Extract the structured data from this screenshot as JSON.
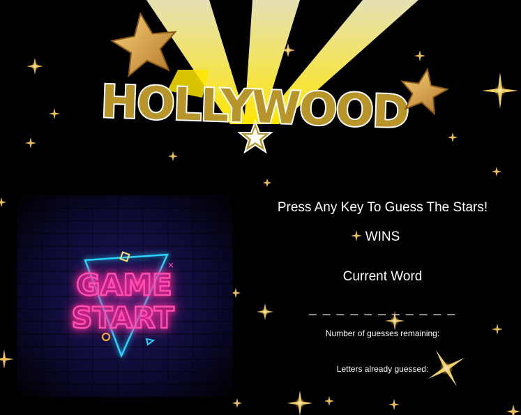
{
  "logo": {
    "text": "HOLLYWOOD"
  },
  "start_button": {
    "line1": "GAME",
    "line2": "START"
  },
  "game": {
    "prompt": "Press Any Key To Guess The Stars!",
    "wins_label": "WINS",
    "current_word_label": "Current Word",
    "current_word_blanks": "_ _ _ _ _ _ _ _ _ _ _",
    "guesses_remaining_label": "Number of guesses remaining:",
    "letters_guessed_label": "Letters already guessed:"
  },
  "colors": {
    "background": "#000000",
    "gold": "#b8952a",
    "neon_pink": "#ff4fb0",
    "neon_cyan": "#2ad4ff",
    "text": "#ffffff"
  }
}
